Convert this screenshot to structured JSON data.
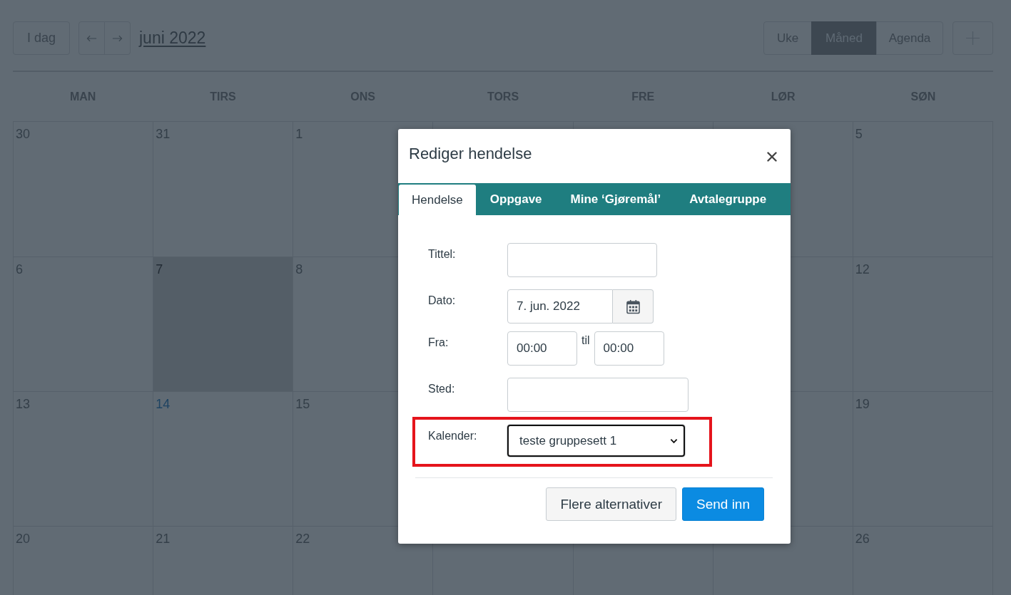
{
  "toolbar": {
    "today": "I dag",
    "month_title": "juni 2022",
    "views": [
      {
        "label": "Uke",
        "selected": false
      },
      {
        "label": "Måned",
        "selected": true
      },
      {
        "label": "Agenda",
        "selected": false
      }
    ]
  },
  "calendar": {
    "weekdays": [
      "MAN",
      "TIRS",
      "ONS",
      "TORS",
      "FRE",
      "LØR",
      "SØN"
    ],
    "weeks": [
      {
        "start": [
          {
            "day": "30",
            "selected": false,
            "today": false
          },
          {
            "day": "31",
            "selected": false,
            "today": false
          },
          {
            "day": "1",
            "selected": false,
            "today": false
          }
        ],
        "end": [
          {
            "selected": false
          },
          {
            "day": "5",
            "selected": false,
            "today": false
          }
        ]
      },
      {
        "start": [
          {
            "day": "6",
            "selected": false,
            "today": false
          },
          {
            "day": "7",
            "selected": true,
            "today": false
          },
          {
            "day": "8",
            "selected": false,
            "today": false
          }
        ],
        "end": [
          {
            "selected": false
          },
          {
            "day": "12",
            "selected": false,
            "today": false
          }
        ]
      },
      {
        "start": [
          {
            "day": "13",
            "selected": false,
            "today": false
          },
          {
            "day": "14",
            "selected": false,
            "today": true
          },
          {
            "day": "15",
            "selected": false,
            "today": false
          }
        ],
        "end": [
          {
            "selected": false
          },
          {
            "day": "19",
            "selected": false,
            "today": false
          }
        ]
      },
      {
        "start": [
          {
            "day": "20",
            "selected": false,
            "today": false
          },
          {
            "day": "21",
            "selected": false,
            "today": false
          },
          {
            "day": "22",
            "selected": false,
            "today": false
          }
        ],
        "end": [
          {
            "selected": false
          },
          {
            "day": "26",
            "selected": false,
            "today": false
          }
        ]
      }
    ]
  },
  "dialog": {
    "title": "Rediger hendelse",
    "tabs": [
      {
        "label": "Hendelse",
        "selected": true
      },
      {
        "label": "Oppgave",
        "selected": false
      },
      {
        "label": "Mine ‘Gjøremål’",
        "selected": false
      },
      {
        "label": "Avtalegruppe",
        "selected": false
      }
    ],
    "fields": [
      {
        "kind": "text",
        "label": "Tittel:"
      },
      {
        "kind": "date",
        "label": "Dato:",
        "value": "7. jun. 2022"
      },
      {
        "kind": "timerange",
        "label": "Fra:",
        "from": "00:00",
        "separator": "til",
        "to": "00:00"
      },
      {
        "kind": "widetext",
        "label": "Sted:"
      },
      {
        "kind": "select",
        "label": "Kalender:",
        "value": "teste gruppesett 1",
        "focused": true,
        "highlighted": true
      }
    ],
    "buttons": [
      {
        "kind": "secondary",
        "label": "Flere alternativer"
      },
      {
        "kind": "primary",
        "label": "Send inn"
      }
    ]
  }
}
